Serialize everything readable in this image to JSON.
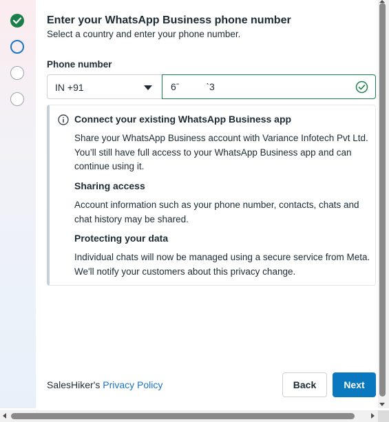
{
  "steps": [
    {
      "state": "completed",
      "icon": "check-icon"
    },
    {
      "state": "active"
    },
    {
      "state": "pending"
    },
    {
      "state": "pending"
    }
  ],
  "header": {
    "title": "Enter your WhatsApp Business phone number",
    "subtitle": "Select a country and enter your phone number."
  },
  "phone_form": {
    "label": "Phone number",
    "country_code": "IN +91",
    "phone_value": "6ˉ          ˋ3",
    "valid_icon": "check-circle-icon"
  },
  "info": {
    "icon": "info-icon",
    "heading": "Connect your existing WhatsApp Business app",
    "intro": "Share your WhatsApp Business account with Variance Infotech Pvt Ltd. You’ll still have full access to your WhatsApp Business app and can continue using it.",
    "sharing_heading": "Sharing access",
    "sharing_body": "Account information such as your phone number, contacts, chats and chat history may be shared.",
    "protecting_heading": "Protecting your data",
    "protecting_body": "Individual chats will now be managed using a secure service from Meta. We'll notify your customers about this privacy change."
  },
  "footer": {
    "owner_text": "SalesHiker's",
    "privacy_link": "Privacy Policy",
    "back_label": "Back",
    "next_label": "Next"
  },
  "colors": {
    "accent": "#0a78be",
    "success": "#1a7f4b",
    "link": "#1b74c5"
  }
}
